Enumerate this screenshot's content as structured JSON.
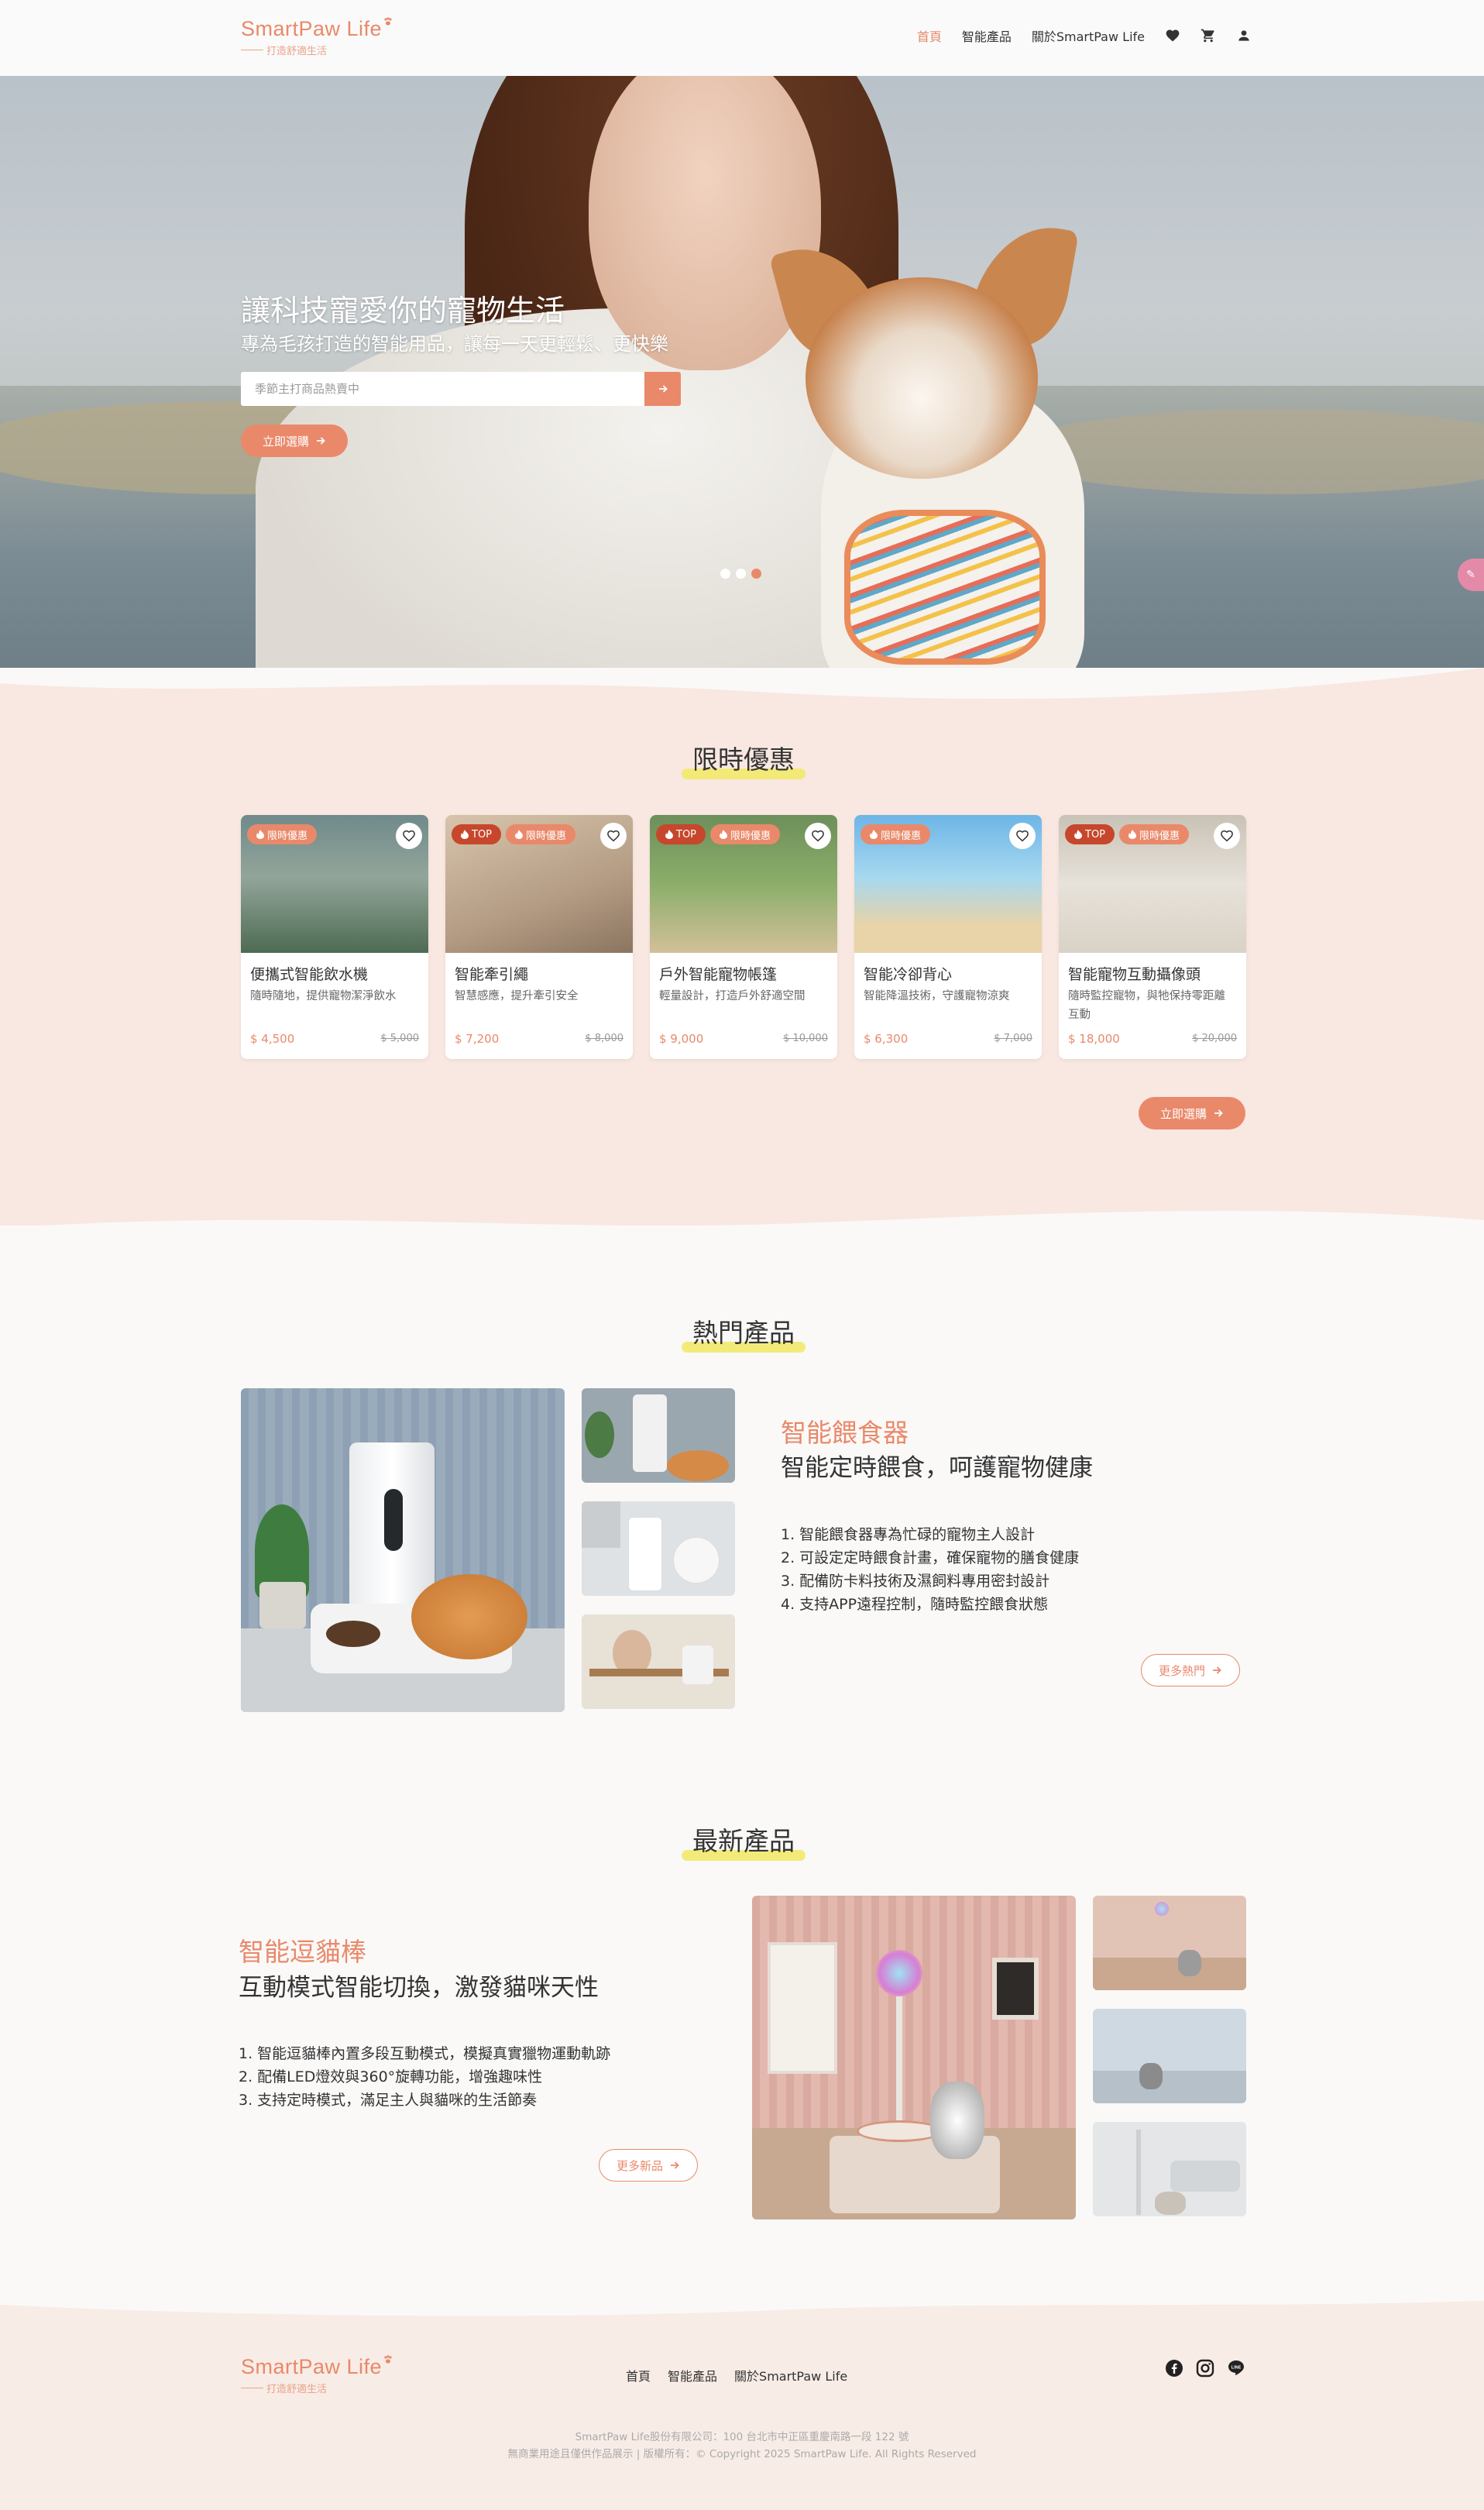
{
  "brand": {
    "name": "SmartPaw Life",
    "tagline": "打造舒適生活"
  },
  "nav": {
    "home": "首頁",
    "products": "智能產品",
    "about": "關於SmartPaw Life"
  },
  "hero": {
    "title": "讓科技寵愛你的寵物生活",
    "subtitle": "專為毛孩打造的智能用品，讓每一天更輕鬆、更快樂",
    "search_placeholder": "季節主打商品熱賣中",
    "cta": "立即選購",
    "slide_count": 3,
    "active_slide": 3
  },
  "sale": {
    "title": "限時優惠",
    "cta": "立即選購",
    "products": [
      {
        "name": "便攜式智能飲水機",
        "desc": "隨時隨地，提供寵物潔淨飲水",
        "price": "$ 4,500",
        "old_price": "$ 5,000",
        "top": false,
        "badge": "限時優惠"
      },
      {
        "name": "智能牽引繩",
        "desc": "智慧感應，提升牽引安全",
        "price": "$ 7,200",
        "old_price": "$ 8,000",
        "top": true,
        "top_label": "TOP",
        "badge": "限時優惠"
      },
      {
        "name": "戶外智能寵物帳篷",
        "desc": "輕量設計，打造戶外舒適空間",
        "price": "$ 9,000",
        "old_price": "$ 10,000",
        "top": true,
        "top_label": "TOP",
        "badge": "限時優惠"
      },
      {
        "name": "智能冷卻背心",
        "desc": "智能降溫技術，守護寵物涼爽",
        "price": "$ 6,300",
        "old_price": "$ 7,000",
        "top": false,
        "badge": "限時優惠"
      },
      {
        "name": "智能寵物互動攝像頭",
        "desc": "隨時監控寵物，與牠保持零距離互動",
        "price": "$ 18,000",
        "old_price": "$ 20,000",
        "top": true,
        "top_label": "TOP",
        "badge": "限時優惠"
      }
    ]
  },
  "hot": {
    "section_title": "熱門產品",
    "title": "智能餵食器",
    "subtitle": "智能定時餵食，呵護寵物健康",
    "features": [
      "1. 智能餵食器專為忙碌的寵物主人設計",
      "2. 可設定定時餵食計畫，確保寵物的膳食健康",
      "3. 配備防卡料技術及濕飼料專用密封設計",
      "4. 支持APP遠程控制，隨時監控餵食狀態"
    ],
    "more": "更多熱門"
  },
  "latest": {
    "section_title": "最新產品",
    "title": "智能逗貓棒",
    "subtitle": "互動模式智能切換，激發貓咪天性",
    "features": [
      "1. 智能逗貓棒內置多段互動模式，模擬真實獵物運動軌跡",
      "2. 配備LED燈效與360°旋轉功能，增強趣味性",
      "3. 支持定時模式，滿足主人與貓咪的生活節奏"
    ],
    "more": "更多新品"
  },
  "footer": {
    "company": "SmartPaw Life股份有限公司：100 台北市中正區重慶南路一段 122 號",
    "copyright": "無商業用途且僅供作品展示 | 版權所有：© Copyright 2025 SmartPaw Life. All Rights Reserved"
  },
  "colors": {
    "accent": "#e9896a",
    "sale_bg": "#f8e8e1",
    "highlight": "#f2e96a",
    "top_badge": "#c6472c"
  },
  "icons": [
    "heart-icon",
    "cart-icon",
    "user-icon",
    "arrow-right-icon",
    "fire-icon",
    "facebook-icon",
    "instagram-icon",
    "line-icon"
  ]
}
